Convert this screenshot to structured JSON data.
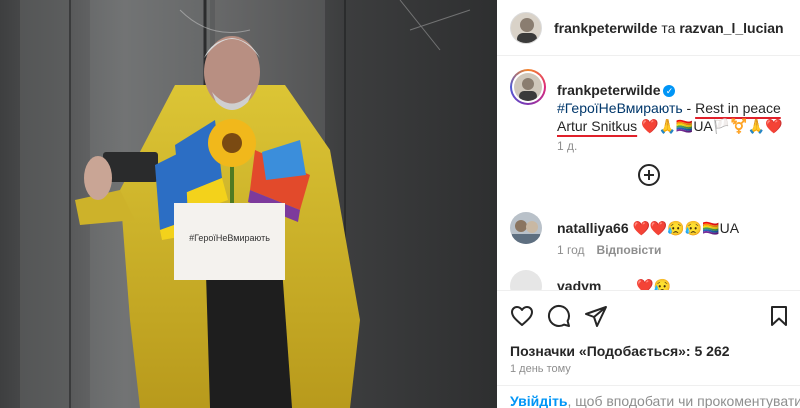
{
  "post": {
    "header": {
      "author": "frankpeterwilde",
      "separator": "та",
      "collaborator": "razvan_l_lucian"
    },
    "caption": {
      "author": "frankpeterwilde",
      "hashtag": "#ГероїНеВмирають",
      "dash": " - ",
      "text_line1": "Rest in peace",
      "text_line2": "Artur Snitkus",
      "emojis": "❤️🙏🏳️‍🌈UA🏳️⚧️🙏❤️",
      "time": "1 д."
    },
    "comments": [
      {
        "user": "natalliya66",
        "text": "❤️❤️😥😥🏳️‍🌈UA",
        "time": "1 год",
        "reply_label": "Відповісти"
      },
      {
        "user": "vadym____",
        "text": "❤️😥"
      }
    ],
    "likes_text": "Позначки «Подобається»: 5 262",
    "date_text": "1 день тому",
    "login_prompt": {
      "link": "Увійдіть",
      "rest": ", щоб вподобати чи прокоментувати."
    },
    "photo_sign_text": "#ГероїНеВмирають"
  },
  "icons": [
    "heart-icon",
    "comment-icon",
    "share-icon",
    "bookmark-icon",
    "plus-circle-icon",
    "verified-badge-icon"
  ],
  "colors": {
    "link_blue": "#0095f6",
    "hashtag_blue": "#00376b",
    "underline_red": "#e0202a",
    "coat_yellow": "#d8be2a",
    "muted_text": "#8e8e8e"
  }
}
